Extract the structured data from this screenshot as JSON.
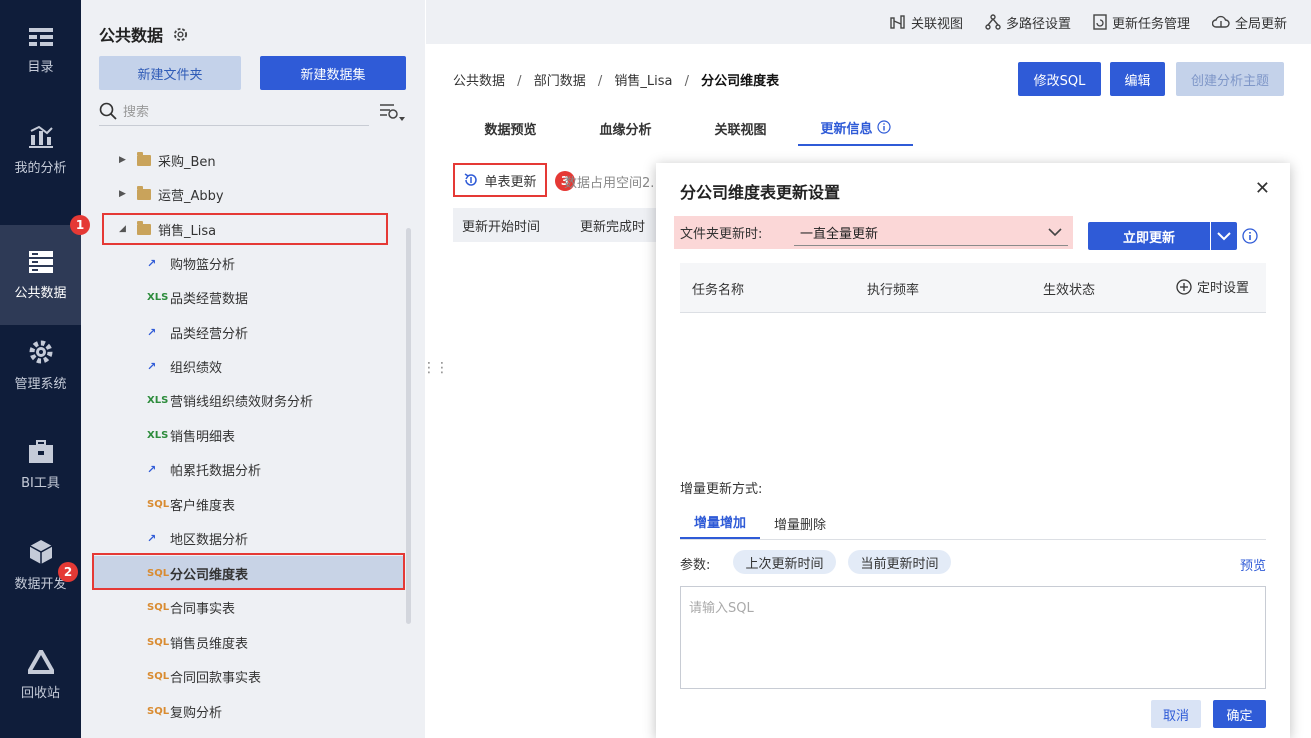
{
  "leftnav": {
    "items": [
      {
        "label": "目录",
        "icon": "catalog-icon"
      },
      {
        "label": "我的分析",
        "icon": "analysis-icon"
      },
      {
        "label": "公共数据",
        "icon": "public-data-icon",
        "active": true
      },
      {
        "label": "管理系统",
        "icon": "settings-gear-icon"
      },
      {
        "label": "BI工具",
        "icon": "toolbox-icon"
      },
      {
        "label": "数据开发",
        "icon": "cube-icon"
      },
      {
        "label": "回收站",
        "icon": "recycle-icon"
      }
    ]
  },
  "tree": {
    "title": "公共数据",
    "new_folder": "新建文件夹",
    "new_dataset": "新建数据集",
    "search_placeholder": "搜索",
    "items": [
      {
        "label": "采购_Ben",
        "type": "folder",
        "expanded": false
      },
      {
        "label": "运营_Abby",
        "type": "folder",
        "expanded": false
      },
      {
        "label": "销售_Lisa",
        "type": "folder",
        "expanded": true
      },
      {
        "label": "购物篮分析",
        "type": "analysis"
      },
      {
        "label": "品类经营数据",
        "type": "excel"
      },
      {
        "label": "品类经营分析",
        "type": "analysis"
      },
      {
        "label": "组织绩效",
        "type": "analysis"
      },
      {
        "label": "营销线组织绩效财务分析",
        "type": "excel"
      },
      {
        "label": "销售明细表",
        "type": "excel"
      },
      {
        "label": "帕累托数据分析",
        "type": "analysis"
      },
      {
        "label": "客户维度表",
        "type": "sql"
      },
      {
        "label": "地区数据分析",
        "type": "analysis"
      },
      {
        "label": "分公司维度表",
        "type": "sql",
        "selected": true
      },
      {
        "label": "合同事实表",
        "type": "sql"
      },
      {
        "label": "销售员维度表",
        "type": "sql"
      },
      {
        "label": "合同回款事实表",
        "type": "sql"
      },
      {
        "label": "复购分析",
        "type": "sql"
      }
    ]
  },
  "badges": [
    "1",
    "2",
    "3"
  ],
  "topbar": {
    "items": [
      {
        "label": "关联视图",
        "icon": "relation-view-icon"
      },
      {
        "label": "多路径设置",
        "icon": "multipath-icon"
      },
      {
        "label": "更新任务管理",
        "icon": "task-manage-icon"
      },
      {
        "label": "全局更新",
        "icon": "cloud-update-icon"
      }
    ]
  },
  "breadcrumb": {
    "parts": [
      "公共数据",
      "部门数据",
      "销售_Lisa"
    ],
    "current": "分公司维度表",
    "sep": "/"
  },
  "header_buttons": {
    "edit_sql": "修改SQL",
    "edit": "编辑",
    "create_topic": "创建分析主题"
  },
  "tabs": [
    "数据预览",
    "血缘分析",
    "关联视图",
    "更新信息"
  ],
  "update_panel": {
    "single_update": "单表更新",
    "space_text": "数据占用空间2.",
    "col1": "更新开始时间",
    "col2": "更新完成时"
  },
  "dialog": {
    "title": "分公司维度表更新设置",
    "folder_update_label": "文件夹更新时:",
    "folder_update_value": "一直全量更新",
    "update_now": "立即更新",
    "columns": [
      "任务名称",
      "执行频率",
      "生效状态"
    ],
    "schedule": "定时设置",
    "incremental_label": "增量更新方式:",
    "inc_tabs": [
      "增量增加",
      "增量删除"
    ],
    "params_label": "参数:",
    "param_chips": [
      "上次更新时间",
      "当前更新时间"
    ],
    "preview": "预览",
    "sql_placeholder": "请输入SQL",
    "cancel": "取消",
    "ok": "确定"
  }
}
